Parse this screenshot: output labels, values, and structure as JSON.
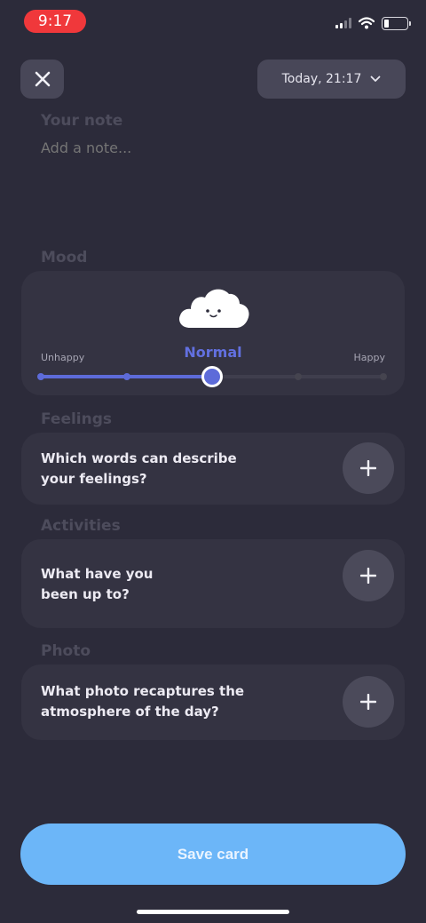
{
  "status_bar": {
    "time": "9:17"
  },
  "header": {
    "date_label": "Today, 21:17"
  },
  "note": {
    "label": "Your note",
    "placeholder": "Add a note..."
  },
  "mood": {
    "label": "Mood",
    "value_label": "Normal",
    "min_label": "Unhappy",
    "max_label": "Happy",
    "steps": 5,
    "selected_step": 3
  },
  "feelings": {
    "label": "Feelings",
    "question": "Which words can describe your feelings?"
  },
  "activities": {
    "label": "Activities",
    "question": "What have you been up to?"
  },
  "photo": {
    "label": "Photo",
    "question": "What photo recaptures the atmosphere of the day?"
  },
  "footer": {
    "save_label": "Save card"
  },
  "colors": {
    "background": "#2c2b3a",
    "accent": "#5d6bd9",
    "save_button": "#6cb6f8",
    "status_time": "#f0383b"
  }
}
